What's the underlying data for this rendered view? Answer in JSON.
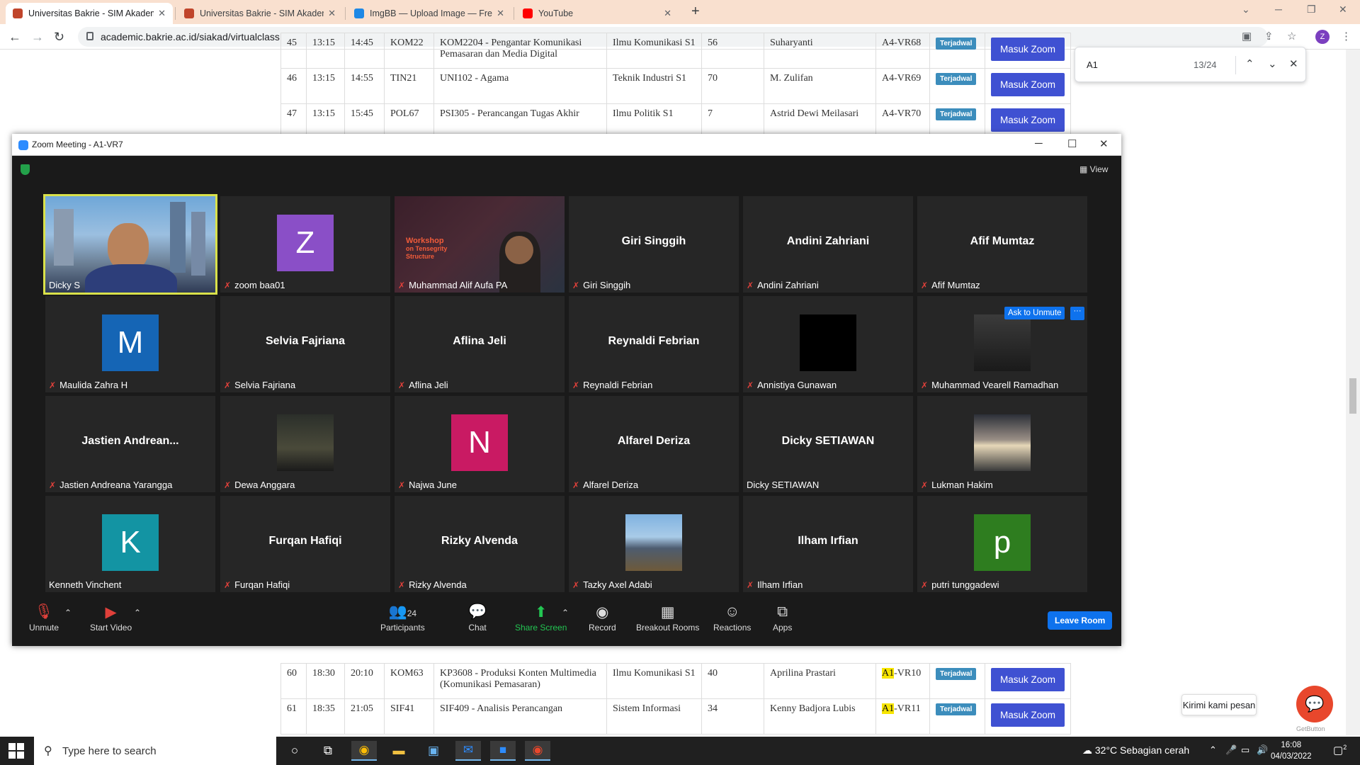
{
  "browser": {
    "tabs": [
      {
        "title": "Universitas Bakrie - SIM Akademik",
        "fav": "#c0452b",
        "active": true
      },
      {
        "title": "Universitas Bakrie - SIM Akademik",
        "fav": "#c0452b",
        "active": false
      },
      {
        "title": "ImgBB — Upload Image — Free Image Hosting",
        "fav": "#1e88e5",
        "active": false
      },
      {
        "title": "YouTube",
        "fav": "#ff0000",
        "active": false
      }
    ],
    "url": "academic.bakrie.ac.id/siakad/virtualclass",
    "profile_initial": "Z"
  },
  "find_bar": {
    "query": "A1",
    "count": "13/24"
  },
  "table": {
    "rows_top": [
      [
        "45",
        "13:15",
        "14:45",
        "KOM22",
        "KOM2204 - Pengantar Komunikasi Pemasaran dan Media Digital",
        "Ilmu Komunikasi S1",
        "56",
        "Suharyanti",
        "A4-VR68"
      ],
      [
        "46",
        "13:15",
        "14:55",
        "TIN21",
        "UNI102 - Agama",
        "Teknik Industri S1",
        "70",
        "M. Zulifan",
        "A4-VR69"
      ],
      [
        "47",
        "13:15",
        "15:45",
        "POL67",
        "PSI305 - Perancangan Tugas Akhir",
        "Ilmu Politik S1",
        "7",
        "Astrid Dewi Meilasari",
        "A4-VR70"
      ]
    ],
    "rows_bottom": [
      [
        "60",
        "18:30",
        "20:10",
        "KOM63",
        "KP3608 - Produksi Konten Multimedia (Komunikasi Pemasaran)",
        "Ilmu Komunikasi S1",
        "40",
        "Aprilina Prastari",
        "VR10"
      ],
      [
        "61",
        "18:35",
        "21:05",
        "SIF41",
        "SIF409 - Analisis Perancangan",
        "Sistem Informasi",
        "34",
        "Kenny Badjora Lubis",
        "VR11"
      ]
    ],
    "highlight": "A1",
    "status_label": "Terjadwal",
    "zoom_button": "Masuk Zoom"
  },
  "chat_widget": {
    "label": "Kirimi kami pesan",
    "brand": "GetButton"
  },
  "zoom": {
    "window_title": "Zoom Meeting - A1-VR7",
    "view_label": "View",
    "ask_to_unmute": "Ask to Unmute",
    "more": "···",
    "participants": [
      {
        "name": "Dicky S",
        "kind": "video",
        "muted": false,
        "active": true
      },
      {
        "name": "zoom baa01",
        "kind": "avatar",
        "letter": "Z",
        "color": "#8a4fc7",
        "muted": true
      },
      {
        "name": "Muhammad Alif Aufa PA",
        "kind": "video2",
        "muted": true
      },
      {
        "name": "Giri Singgih",
        "kind": "name",
        "muted": true
      },
      {
        "name": "Andini Zahriani",
        "kind": "name",
        "muted": true
      },
      {
        "name": "Afif Mumtaz",
        "kind": "name",
        "muted": true
      },
      {
        "name": "Maulida Zahra H",
        "kind": "avatar",
        "letter": "M",
        "color": "#1565b5",
        "muted": true
      },
      {
        "name": "Selvia Fajriana",
        "kind": "name",
        "muted": true
      },
      {
        "name": "Aflina Jeli",
        "kind": "name",
        "muted": true
      },
      {
        "name": "Reynaldi Febrian",
        "kind": "name",
        "muted": true
      },
      {
        "name": "Annistiya Gunawan",
        "kind": "black",
        "muted": true
      },
      {
        "name": "Muhammad Vearell Ramadhan",
        "kind": "photo",
        "photo": "dark",
        "muted": true
      },
      {
        "name": "Jastien Andreana Yarangga",
        "kind": "name",
        "label": "Jastien  Andrean...",
        "muted": true
      },
      {
        "name": "Dewa Anggara",
        "kind": "photo",
        "photo": "street",
        "muted": true
      },
      {
        "name": "Najwa June",
        "kind": "avatar",
        "letter": "N",
        "color": "#c91a63",
        "muted": true
      },
      {
        "name": "Alfarel Deriza",
        "kind": "name",
        "muted": true
      },
      {
        "name": "Dicky SETIAWAN",
        "kind": "name",
        "muted": false
      },
      {
        "name": "Lukman Hakim",
        "kind": "photo",
        "photo": "sunset",
        "muted": true
      },
      {
        "name": "Kenneth Vinchent",
        "kind": "avatar",
        "letter": "K",
        "color": "#1394a3",
        "muted": false
      },
      {
        "name": "Furqan Hafiqi",
        "kind": "name",
        "muted": true
      },
      {
        "name": "Rizky Alvenda",
        "kind": "name",
        "muted": true
      },
      {
        "name": "Tazky Axel Adabi",
        "kind": "photo",
        "photo": "mountain",
        "muted": true
      },
      {
        "name": "Ilham Irfian",
        "kind": "name",
        "muted": true
      },
      {
        "name": "putri tunggadewi",
        "kind": "avatar",
        "letter": "p",
        "color": "#2e7d1f",
        "muted": true
      }
    ],
    "video2_text": {
      "line1": "Workshop",
      "line2": "on Tensegrity",
      "line3": "Structure"
    },
    "controls": {
      "unmute": "Unmute",
      "start_video": "Start Video",
      "participants": "Participants",
      "participants_count": "24",
      "chat": "Chat",
      "share_screen": "Share Screen",
      "record": "Record",
      "breakout_rooms": "Breakout Rooms",
      "reactions": "Reactions",
      "apps": "Apps",
      "leave_room": "Leave Room"
    }
  },
  "taskbar": {
    "search_placeholder": "Type here to search",
    "weather": "32°C  Sebagian cerah",
    "time": "16:08",
    "date": "04/03/2022",
    "notifications": "2"
  }
}
